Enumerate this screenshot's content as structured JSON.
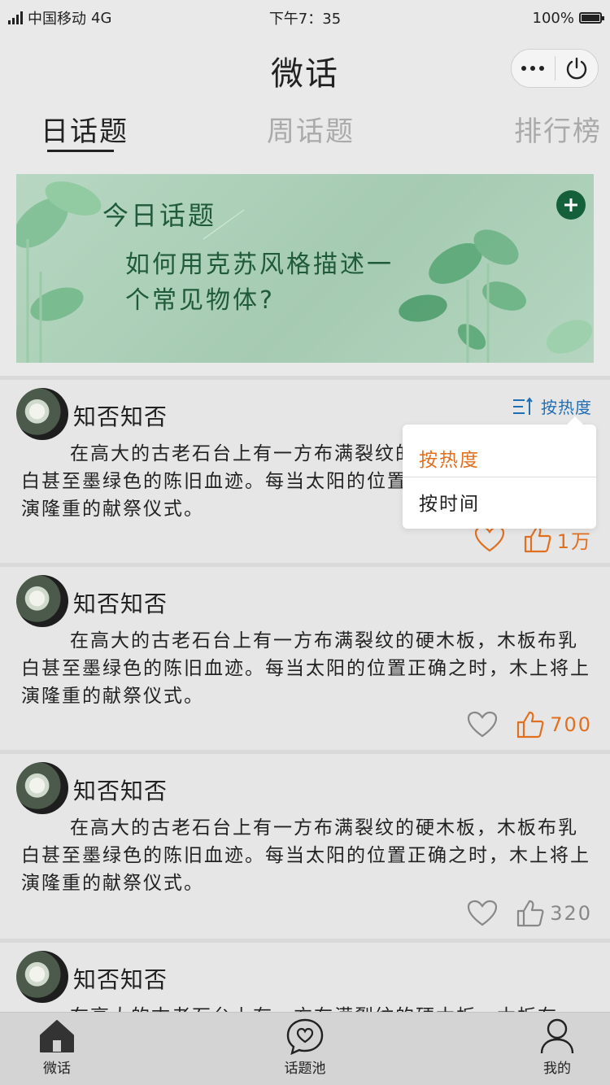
{
  "status_bar": {
    "carrier": "中国移动",
    "network": "4G",
    "time": "下午7：35",
    "battery": "100%"
  },
  "header": {
    "title": "微话"
  },
  "tabs": [
    {
      "label": "日话题",
      "active": true
    },
    {
      "label": "周话题",
      "active": false
    },
    {
      "label": "排行榜",
      "active": false
    }
  ],
  "banner": {
    "label": "今日话题",
    "topic": "如何用克苏风格描述一个常见物体?"
  },
  "sort": {
    "current": "按热度",
    "options": [
      "按热度",
      "按时间"
    ]
  },
  "posts": [
    {
      "author": "知否知否",
      "content": "在高大的古老石台上有一方布满裂纹的硬木板，木板布乳白甚至墨绿色的陈旧血迹。每当太阳的位置正确之时，木上将上演隆重的献祭仪式。",
      "likes": "1万",
      "hot": true
    },
    {
      "author": "知否知否",
      "content": "在高大的古老石台上有一方布满裂纹的硬木板，木板布乳白甚至墨绿色的陈旧血迹。每当太阳的位置正确之时，木上将上演隆重的献祭仪式。",
      "likes": "700",
      "hot": true
    },
    {
      "author": "知否知否",
      "content": "在高大的古老石台上有一方布满裂纹的硬木板，木板布乳白甚至墨绿色的陈旧血迹。每当太阳的位置正确之时，木上将上演隆重的献祭仪式。",
      "likes": "320",
      "hot": false
    },
    {
      "author": "知否知否",
      "content": "在高大的古老石台上有一方布满裂纹的硬木板，木板布",
      "likes": "",
      "hot": false
    }
  ],
  "tabbar": [
    {
      "label": "微话",
      "icon": "home-icon",
      "active": true
    },
    {
      "label": "话题池",
      "icon": "chat-heart-icon",
      "active": false
    },
    {
      "label": "我的",
      "icon": "user-icon",
      "active": false
    }
  ],
  "colors": {
    "accent_orange": "#e07020",
    "sort_blue": "#1f6fb5",
    "banner_green": "#1f5a3a"
  }
}
